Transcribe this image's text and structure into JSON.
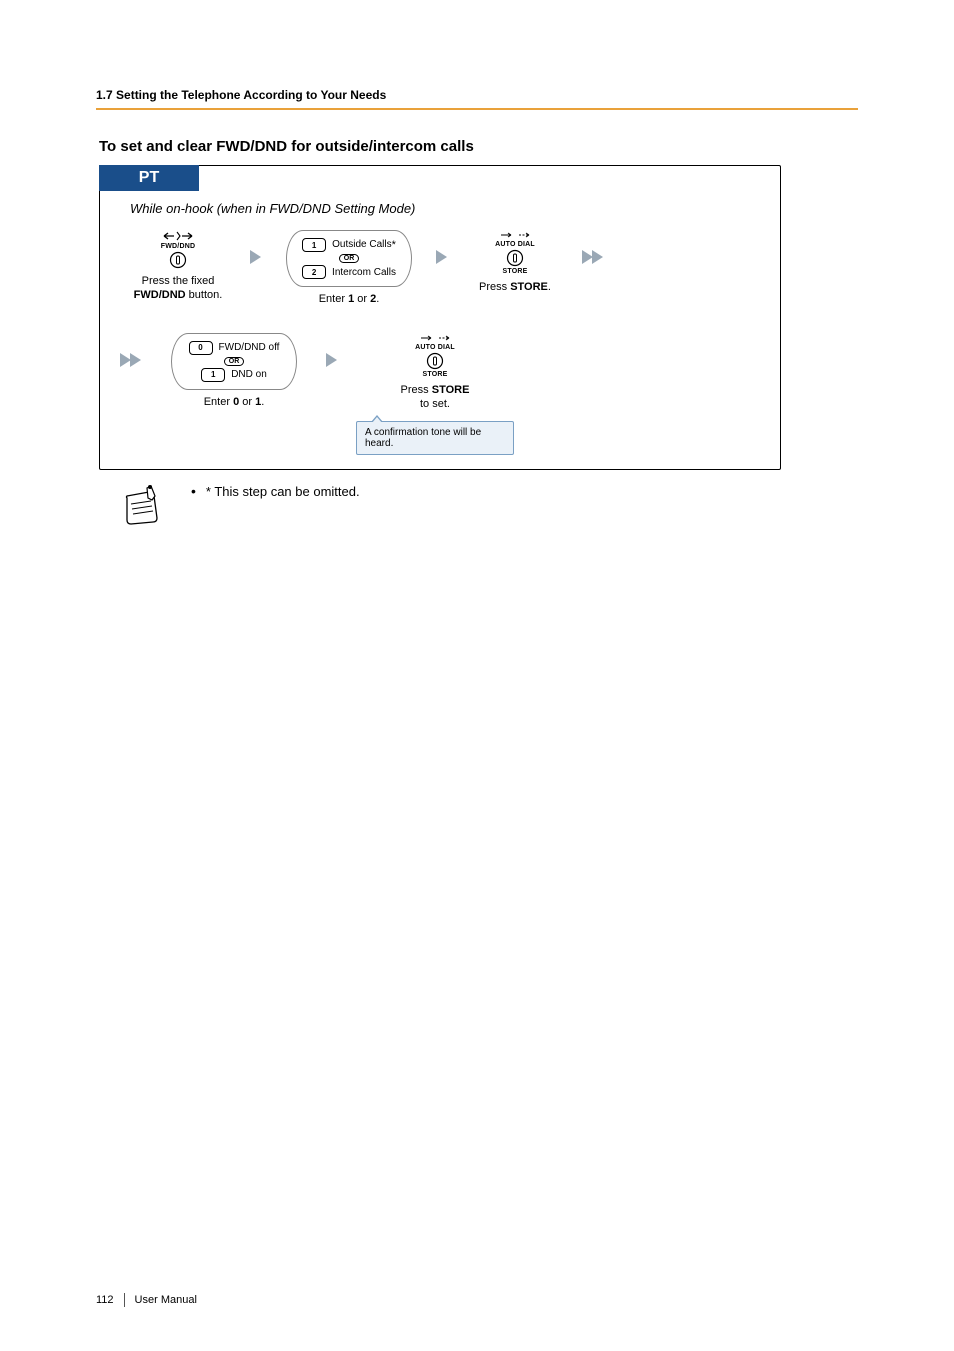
{
  "header": {
    "section": "1.7 Setting the Telephone According to Your Needs"
  },
  "subheading": "To set and clear FWD/DND for outside/intercom calls",
  "diagram": {
    "tab": "PT",
    "context": "While on-hook (when in FWD/DND Setting Mode)",
    "fwddnd_label": "FWD/DND",
    "autodial_label": "AUTO DIAL",
    "store_label": "STORE",
    "step1_caption_a": "Press the fixed",
    "step1_caption_b": "FWD/DND",
    "step1_caption_c": " button.",
    "step2_opt1_key": "1",
    "step2_opt1_text": "Outside Calls",
    "step2_opt2_key": "2",
    "step2_opt2_text": "Intercom Calls",
    "or": "OR",
    "step2_caption_a": "Enter ",
    "step2_caption_b": "1",
    "step2_caption_c": " or ",
    "step2_caption_d": "2",
    "step2_caption_e": ".",
    "step3_caption_a": "Press ",
    "step3_caption_b": "STORE",
    "step3_caption_c": ".",
    "step4_opt1_key": "0",
    "step4_opt1_text": "FWD/DND off",
    "step4_opt2_key": "1",
    "step4_opt2_text": "DND on",
    "step4_caption_a": "Enter ",
    "step4_caption_b": "0",
    "step4_caption_c": " or ",
    "step4_caption_d": "1",
    "step4_caption_e": ".",
    "step5_caption_a": "Press ",
    "step5_caption_b": "STORE",
    "step5_caption_c": " to set.",
    "confirm": "A confirmation tone will be heard."
  },
  "note": {
    "text": "* This step can be omitted."
  },
  "footer": {
    "page": "112",
    "manual": "User Manual"
  }
}
